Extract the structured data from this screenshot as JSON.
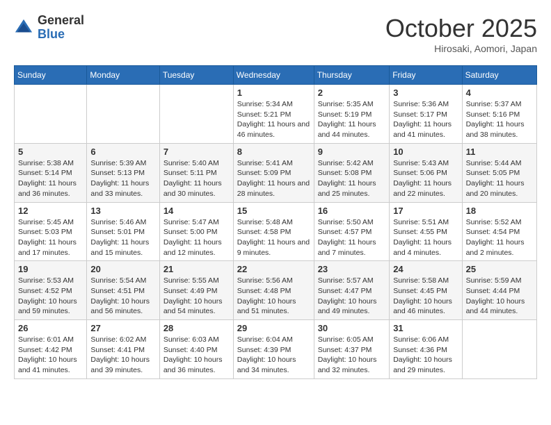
{
  "header": {
    "logo_general": "General",
    "logo_blue": "Blue",
    "month": "October 2025",
    "location": "Hirosaki, Aomori, Japan"
  },
  "weekdays": [
    "Sunday",
    "Monday",
    "Tuesday",
    "Wednesday",
    "Thursday",
    "Friday",
    "Saturday"
  ],
  "weeks": [
    [
      {
        "day": "",
        "sunrise": "",
        "sunset": "",
        "daylight": ""
      },
      {
        "day": "",
        "sunrise": "",
        "sunset": "",
        "daylight": ""
      },
      {
        "day": "",
        "sunrise": "",
        "sunset": "",
        "daylight": ""
      },
      {
        "day": "1",
        "sunrise": "Sunrise: 5:34 AM",
        "sunset": "Sunset: 5:21 PM",
        "daylight": "Daylight: 11 hours and 46 minutes."
      },
      {
        "day": "2",
        "sunrise": "Sunrise: 5:35 AM",
        "sunset": "Sunset: 5:19 PM",
        "daylight": "Daylight: 11 hours and 44 minutes."
      },
      {
        "day": "3",
        "sunrise": "Sunrise: 5:36 AM",
        "sunset": "Sunset: 5:17 PM",
        "daylight": "Daylight: 11 hours and 41 minutes."
      },
      {
        "day": "4",
        "sunrise": "Sunrise: 5:37 AM",
        "sunset": "Sunset: 5:16 PM",
        "daylight": "Daylight: 11 hours and 38 minutes."
      }
    ],
    [
      {
        "day": "5",
        "sunrise": "Sunrise: 5:38 AM",
        "sunset": "Sunset: 5:14 PM",
        "daylight": "Daylight: 11 hours and 36 minutes."
      },
      {
        "day": "6",
        "sunrise": "Sunrise: 5:39 AM",
        "sunset": "Sunset: 5:13 PM",
        "daylight": "Daylight: 11 hours and 33 minutes."
      },
      {
        "day": "7",
        "sunrise": "Sunrise: 5:40 AM",
        "sunset": "Sunset: 5:11 PM",
        "daylight": "Daylight: 11 hours and 30 minutes."
      },
      {
        "day": "8",
        "sunrise": "Sunrise: 5:41 AM",
        "sunset": "Sunset: 5:09 PM",
        "daylight": "Daylight: 11 hours and 28 minutes."
      },
      {
        "day": "9",
        "sunrise": "Sunrise: 5:42 AM",
        "sunset": "Sunset: 5:08 PM",
        "daylight": "Daylight: 11 hours and 25 minutes."
      },
      {
        "day": "10",
        "sunrise": "Sunrise: 5:43 AM",
        "sunset": "Sunset: 5:06 PM",
        "daylight": "Daylight: 11 hours and 22 minutes."
      },
      {
        "day": "11",
        "sunrise": "Sunrise: 5:44 AM",
        "sunset": "Sunset: 5:05 PM",
        "daylight": "Daylight: 11 hours and 20 minutes."
      }
    ],
    [
      {
        "day": "12",
        "sunrise": "Sunrise: 5:45 AM",
        "sunset": "Sunset: 5:03 PM",
        "daylight": "Daylight: 11 hours and 17 minutes."
      },
      {
        "day": "13",
        "sunrise": "Sunrise: 5:46 AM",
        "sunset": "Sunset: 5:01 PM",
        "daylight": "Daylight: 11 hours and 15 minutes."
      },
      {
        "day": "14",
        "sunrise": "Sunrise: 5:47 AM",
        "sunset": "Sunset: 5:00 PM",
        "daylight": "Daylight: 11 hours and 12 minutes."
      },
      {
        "day": "15",
        "sunrise": "Sunrise: 5:48 AM",
        "sunset": "Sunset: 4:58 PM",
        "daylight": "Daylight: 11 hours and 9 minutes."
      },
      {
        "day": "16",
        "sunrise": "Sunrise: 5:50 AM",
        "sunset": "Sunset: 4:57 PM",
        "daylight": "Daylight: 11 hours and 7 minutes."
      },
      {
        "day": "17",
        "sunrise": "Sunrise: 5:51 AM",
        "sunset": "Sunset: 4:55 PM",
        "daylight": "Daylight: 11 hours and 4 minutes."
      },
      {
        "day": "18",
        "sunrise": "Sunrise: 5:52 AM",
        "sunset": "Sunset: 4:54 PM",
        "daylight": "Daylight: 11 hours and 2 minutes."
      }
    ],
    [
      {
        "day": "19",
        "sunrise": "Sunrise: 5:53 AM",
        "sunset": "Sunset: 4:52 PM",
        "daylight": "Daylight: 10 hours and 59 minutes."
      },
      {
        "day": "20",
        "sunrise": "Sunrise: 5:54 AM",
        "sunset": "Sunset: 4:51 PM",
        "daylight": "Daylight: 10 hours and 56 minutes."
      },
      {
        "day": "21",
        "sunrise": "Sunrise: 5:55 AM",
        "sunset": "Sunset: 4:49 PM",
        "daylight": "Daylight: 10 hours and 54 minutes."
      },
      {
        "day": "22",
        "sunrise": "Sunrise: 5:56 AM",
        "sunset": "Sunset: 4:48 PM",
        "daylight": "Daylight: 10 hours and 51 minutes."
      },
      {
        "day": "23",
        "sunrise": "Sunrise: 5:57 AM",
        "sunset": "Sunset: 4:47 PM",
        "daylight": "Daylight: 10 hours and 49 minutes."
      },
      {
        "day": "24",
        "sunrise": "Sunrise: 5:58 AM",
        "sunset": "Sunset: 4:45 PM",
        "daylight": "Daylight: 10 hours and 46 minutes."
      },
      {
        "day": "25",
        "sunrise": "Sunrise: 5:59 AM",
        "sunset": "Sunset: 4:44 PM",
        "daylight": "Daylight: 10 hours and 44 minutes."
      }
    ],
    [
      {
        "day": "26",
        "sunrise": "Sunrise: 6:01 AM",
        "sunset": "Sunset: 4:42 PM",
        "daylight": "Daylight: 10 hours and 41 minutes."
      },
      {
        "day": "27",
        "sunrise": "Sunrise: 6:02 AM",
        "sunset": "Sunset: 4:41 PM",
        "daylight": "Daylight: 10 hours and 39 minutes."
      },
      {
        "day": "28",
        "sunrise": "Sunrise: 6:03 AM",
        "sunset": "Sunset: 4:40 PM",
        "daylight": "Daylight: 10 hours and 36 minutes."
      },
      {
        "day": "29",
        "sunrise": "Sunrise: 6:04 AM",
        "sunset": "Sunset: 4:39 PM",
        "daylight": "Daylight: 10 hours and 34 minutes."
      },
      {
        "day": "30",
        "sunrise": "Sunrise: 6:05 AM",
        "sunset": "Sunset: 4:37 PM",
        "daylight": "Daylight: 10 hours and 32 minutes."
      },
      {
        "day": "31",
        "sunrise": "Sunrise: 6:06 AM",
        "sunset": "Sunset: 4:36 PM",
        "daylight": "Daylight: 10 hours and 29 minutes."
      },
      {
        "day": "",
        "sunrise": "",
        "sunset": "",
        "daylight": ""
      }
    ]
  ]
}
